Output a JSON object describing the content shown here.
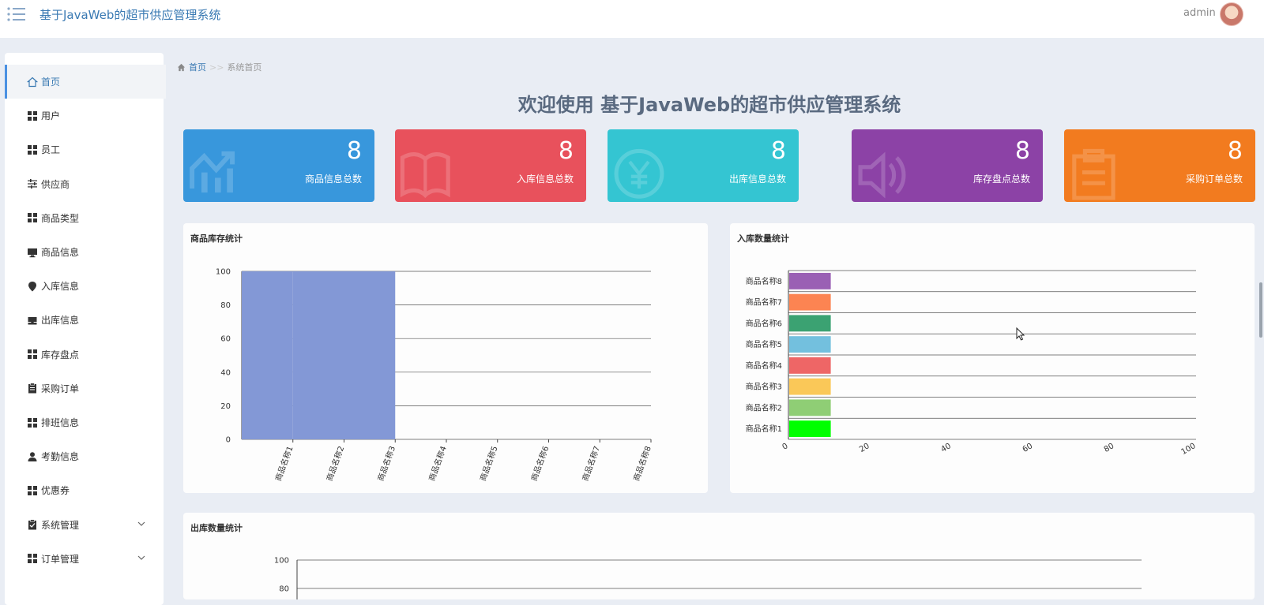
{
  "header": {
    "app_title": "基于JavaWeb的超市供应管理系统",
    "user_name": "admin"
  },
  "sidebar": {
    "items": [
      {
        "label": "首页",
        "icon": "home-icon",
        "active": true
      },
      {
        "label": "用户",
        "icon": "grid-icon"
      },
      {
        "label": "员工",
        "icon": "grid-icon"
      },
      {
        "label": "供应商",
        "icon": "sliders-icon"
      },
      {
        "label": "商品类型",
        "icon": "grid-icon"
      },
      {
        "label": "商品信息",
        "icon": "monitor-icon"
      },
      {
        "label": "入库信息",
        "icon": "map-pin-icon"
      },
      {
        "label": "出库信息",
        "icon": "inbox-icon"
      },
      {
        "label": "库存盘点",
        "icon": "grid-icon"
      },
      {
        "label": "采购订单",
        "icon": "clipboard-icon"
      },
      {
        "label": "排班信息",
        "icon": "grid-icon"
      },
      {
        "label": "考勤信息",
        "icon": "user-icon"
      },
      {
        "label": "优惠券",
        "icon": "grid-icon"
      },
      {
        "label": "系统管理",
        "icon": "clipboard-check-icon",
        "expandable": true
      },
      {
        "label": "订单管理",
        "icon": "grid-icon",
        "expandable": true
      }
    ]
  },
  "breadcrumb": {
    "home": "首页",
    "separator": ">>",
    "current": "系统首页"
  },
  "welcome": "欢迎使用 基于JavaWeb的超市供应管理系统",
  "stats": [
    {
      "value": "8",
      "label": "商品信息总数",
      "color": "#3897dc",
      "icon": "chart-icon"
    },
    {
      "value": "8",
      "label": "入库信息总数",
      "color": "#e8515c",
      "icon": "book-icon"
    },
    {
      "value": "8",
      "label": "出库信息总数",
      "color": "#34c5d2",
      "icon": "yen-icon"
    },
    {
      "value": "8",
      "label": "库存盘点总数",
      "color": "#8c42a6",
      "icon": "speaker-icon"
    },
    {
      "value": "8",
      "label": "采购订单总数",
      "color": "#f27b1f",
      "icon": "clipboard-icon"
    }
  ],
  "panels": {
    "stock_title": "商品库存统计",
    "inbound_title": "入库数量统计",
    "outbound_title": "出库数量统计"
  },
  "chart_data": [
    {
      "type": "bar",
      "title": "商品库存统计",
      "categories": [
        "商品名称1",
        "商品名称2",
        "商品名称3",
        "商品名称4",
        "商品名称5",
        "商品名称6",
        "商品名称7",
        "商品名称8"
      ],
      "values": [
        100,
        100,
        100,
        0,
        0,
        0,
        0,
        0
      ],
      "ylim": [
        0,
        100
      ],
      "yticks": [
        0,
        20,
        40,
        60,
        80,
        100
      ],
      "color": "#8398d6",
      "grid": true
    },
    {
      "type": "bar",
      "orientation": "horizontal",
      "title": "入库数量统计",
      "categories": [
        "商品名称1",
        "商品名称2",
        "商品名称3",
        "商品名称4",
        "商品名称5",
        "商品名称6",
        "商品名称7",
        "商品名称8"
      ],
      "values": [
        10,
        10,
        10,
        10,
        10,
        10,
        10,
        10
      ],
      "colors": [
        "#00ff00",
        "#8fce75",
        "#fac858",
        "#ee6666",
        "#73c0de",
        "#3ba272",
        "#fc8452",
        "#9a60b4"
      ],
      "xlim": [
        0,
        100
      ],
      "xticks": [
        0,
        20,
        40,
        60,
        80,
        100
      ],
      "grid": true
    },
    {
      "type": "bar",
      "title": "出库数量统计",
      "ylim": [
        0,
        100
      ],
      "yticks_visible": [
        80,
        100
      ],
      "grid": true
    }
  ]
}
